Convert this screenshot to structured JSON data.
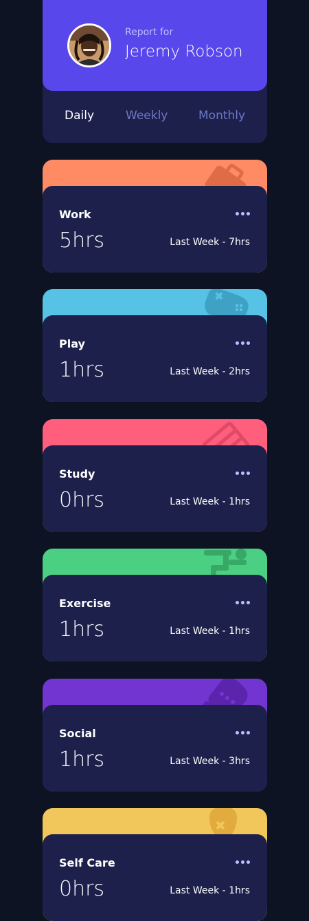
{
  "profile": {
    "report_for": "Report for",
    "name": "Jeremy Robson"
  },
  "tabs": [
    {
      "label": "Daily",
      "active": true
    },
    {
      "label": "Weekly",
      "active": false
    },
    {
      "label": "Monthly",
      "active": false
    }
  ],
  "cards": [
    {
      "title": "Work",
      "hours": "5hrs",
      "last": "Last Week - 7hrs",
      "color": "#ff8b64",
      "icon": "briefcase-icon"
    },
    {
      "title": "Play",
      "hours": "1hrs",
      "last": "Last Week - 2hrs",
      "color": "#55c2e6",
      "icon": "gamepad-icon"
    },
    {
      "title": "Study",
      "hours": "0hrs",
      "last": "Last Week - 1hrs",
      "color": "#ff5e7d",
      "icon": "books-icon"
    },
    {
      "title": "Exercise",
      "hours": "1hrs",
      "last": "Last Week - 1hrs",
      "color": "#4bcf82",
      "icon": "running-icon"
    },
    {
      "title": "Social",
      "hours": "1hrs",
      "last": "Last Week - 3hrs",
      "color": "#7335d2",
      "icon": "chat-icon"
    },
    {
      "title": "Self Care",
      "hours": "0hrs",
      "last": "Last Week - 1hrs",
      "color": "#f1c75b",
      "icon": "heart-care-icon"
    }
  ],
  "colors": {
    "background": "#0d1323",
    "card": "#1c204b",
    "accent": "#5847eb",
    "muted": "#7078c9",
    "pale": "#bbc0ff"
  }
}
